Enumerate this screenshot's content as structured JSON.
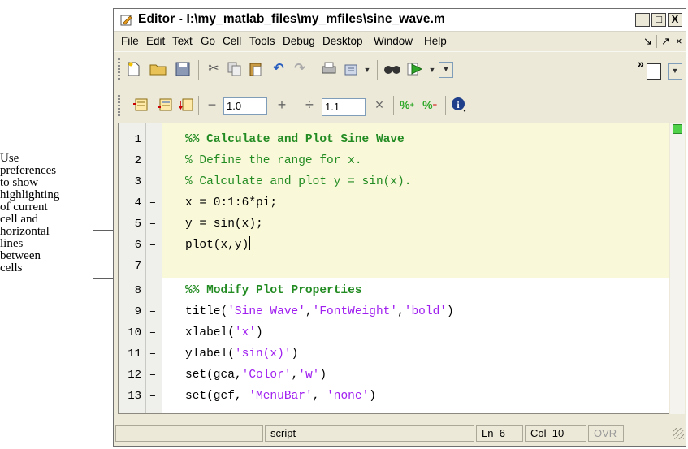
{
  "annotation": {
    "text": "Use\npreferences\nto show\nhighlighting\nof current\ncell and\nhorizontal\nlines\nbetween\ncells"
  },
  "window": {
    "title": "Editor - I:\\my_matlab_files\\my_mfiles\\sine_wave.m",
    "controls": {
      "minimize": "_",
      "maximize": "□",
      "close": "X"
    }
  },
  "menubar": {
    "items": [
      {
        "label": "File"
      },
      {
        "label": "Edit"
      },
      {
        "label": "Text"
      },
      {
        "label": "Go"
      },
      {
        "label": "Cell"
      },
      {
        "label": "Tools"
      },
      {
        "label": "Debug"
      },
      {
        "label": "Desktop"
      },
      {
        "label": "Window"
      },
      {
        "label": "Help"
      }
    ],
    "right_controls": [
      "↘",
      "↗",
      "×"
    ]
  },
  "toolbar": {
    "icons": [
      "new-file-icon",
      "open-folder-icon",
      "save-icon",
      "cut-icon",
      "copy-icon",
      "paste-icon",
      "undo-icon",
      "redo-icon",
      "print-icon",
      "find-icon",
      "run-icon"
    ],
    "more_label": "»"
  },
  "cell_toolbar": {
    "minus_label": "−",
    "plus_label": "+",
    "divide_label": "÷",
    "times_label": "×",
    "increment_value": "1.0",
    "divisor_value": "1.1"
  },
  "editor": {
    "lines": [
      {
        "num": "1",
        "dash": "",
        "text": "%% Calculate and Plot Sine Wave",
        "style": "cell"
      },
      {
        "num": "2",
        "dash": "",
        "text": "% Define the range for x.",
        "style": "comment"
      },
      {
        "num": "3",
        "dash": "",
        "text": "% Calculate and plot y = sin(x).",
        "style": "comment"
      },
      {
        "num": "4",
        "dash": "–",
        "text": "x = 0:1:6*pi;",
        "style": "code"
      },
      {
        "num": "5",
        "dash": "–",
        "text": "y = sin(x);",
        "style": "code"
      },
      {
        "num": "6",
        "dash": "–",
        "text": "plot(x,y)",
        "style": "code"
      },
      {
        "num": "7",
        "dash": "",
        "text": "",
        "style": "code"
      },
      {
        "num": "8",
        "dash": "",
        "text": "%% Modify Plot Properties",
        "style": "cell"
      },
      {
        "num": "9",
        "dash": "–",
        "pre": "title(",
        "str1": "'Sine Wave'",
        "mid": ",",
        "str2": "'FontWeight'",
        "mid2": ",",
        "str3": "'bold'",
        "post": ")",
        "style": "mixed"
      },
      {
        "num": "10",
        "dash": "–",
        "pre": "xlabel(",
        "str1": "'x'",
        "post": ")",
        "style": "mixed"
      },
      {
        "num": "11",
        "dash": "–",
        "pre": "ylabel(",
        "str1": "'sin(x)'",
        "post": ")",
        "style": "mixed"
      },
      {
        "num": "12",
        "dash": "–",
        "pre": "set(gca,",
        "str1": "'Color'",
        "mid": ",",
        "str2": "'w'",
        "post": ")",
        "style": "mixed"
      },
      {
        "num": "13",
        "dash": "–",
        "pre": "set(gcf, ",
        "str1": "'MenuBar'",
        "mid": ", ",
        "str2": "'none'",
        "post": ")",
        "style": "mixed"
      }
    ]
  },
  "statusbar": {
    "mode": "script",
    "ln_label": "Ln",
    "ln_value": "6",
    "col_label": "Col",
    "col_value": "10",
    "ovr": "OVR"
  },
  "colors": {
    "cell_highlight": "#f9f8d9",
    "comment": "#228b22",
    "string": "#a020f0",
    "chrome": "#ece9d8"
  }
}
